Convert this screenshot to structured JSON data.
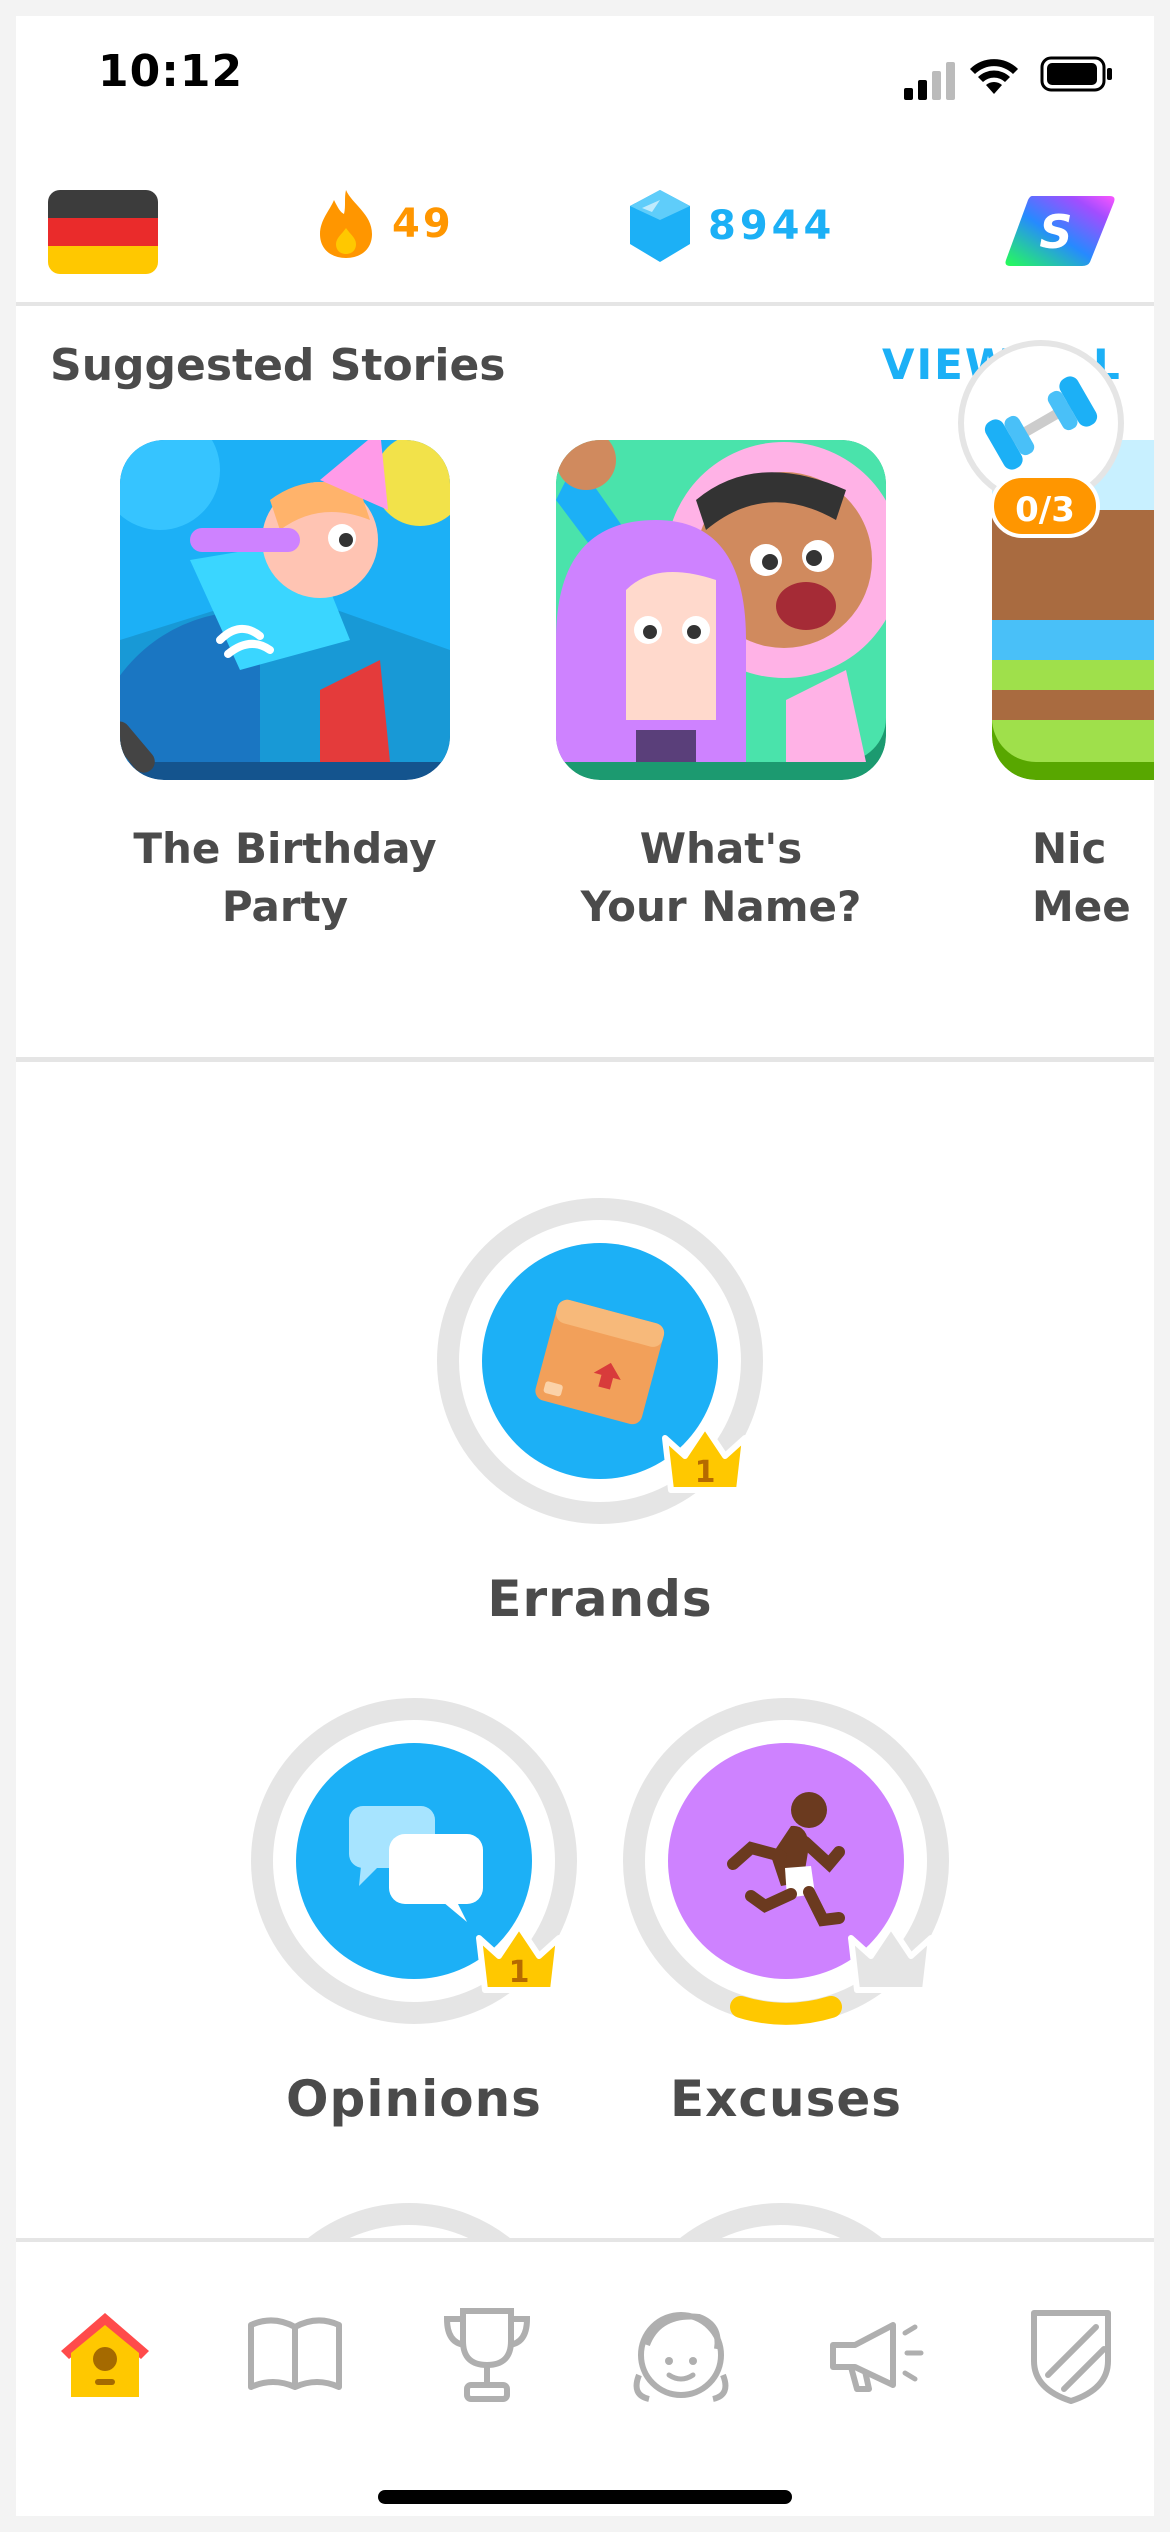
{
  "status_bar": {
    "time": "10:12"
  },
  "top_bar": {
    "language_flag_icon": "germany-flag-icon",
    "streak": {
      "icon": "flame-icon",
      "value": "49"
    },
    "gems": {
      "icon": "gem-icon",
      "value": "8944"
    },
    "super_icon": "super-duolingo-icon"
  },
  "stories": {
    "title": "Suggested Stories",
    "view_all": "VIEW ALL",
    "items": [
      {
        "line1": "The Birthday",
        "line2": "Party"
      },
      {
        "line1": "What's",
        "line2": "Your Name?"
      },
      {
        "line1": "Nic",
        "line2": "Mee"
      }
    ],
    "practice_progress": "0/3"
  },
  "path": {
    "skills": [
      {
        "name": "Errands",
        "crown_level": "1",
        "icon": "box-icon"
      },
      {
        "name": "Opinions",
        "crown_level": "1",
        "icon": "chat-bubbles-icon"
      },
      {
        "name": "Excuses",
        "crown_level": "",
        "icon": "running-person-icon",
        "progress": 0.25
      }
    ]
  },
  "nav": {
    "items": [
      "home-icon",
      "stories-book-icon",
      "leaderboard-trophy-icon",
      "profile-avatar-icon",
      "news-megaphone-icon",
      "shop-shield-icon"
    ],
    "active": "home-icon"
  },
  "colors": {
    "blue": "#1cb0f6",
    "orange": "#ff9600",
    "purple": "#ce82ff",
    "gold": "#ffc800",
    "gray": "#e5e5e5"
  }
}
